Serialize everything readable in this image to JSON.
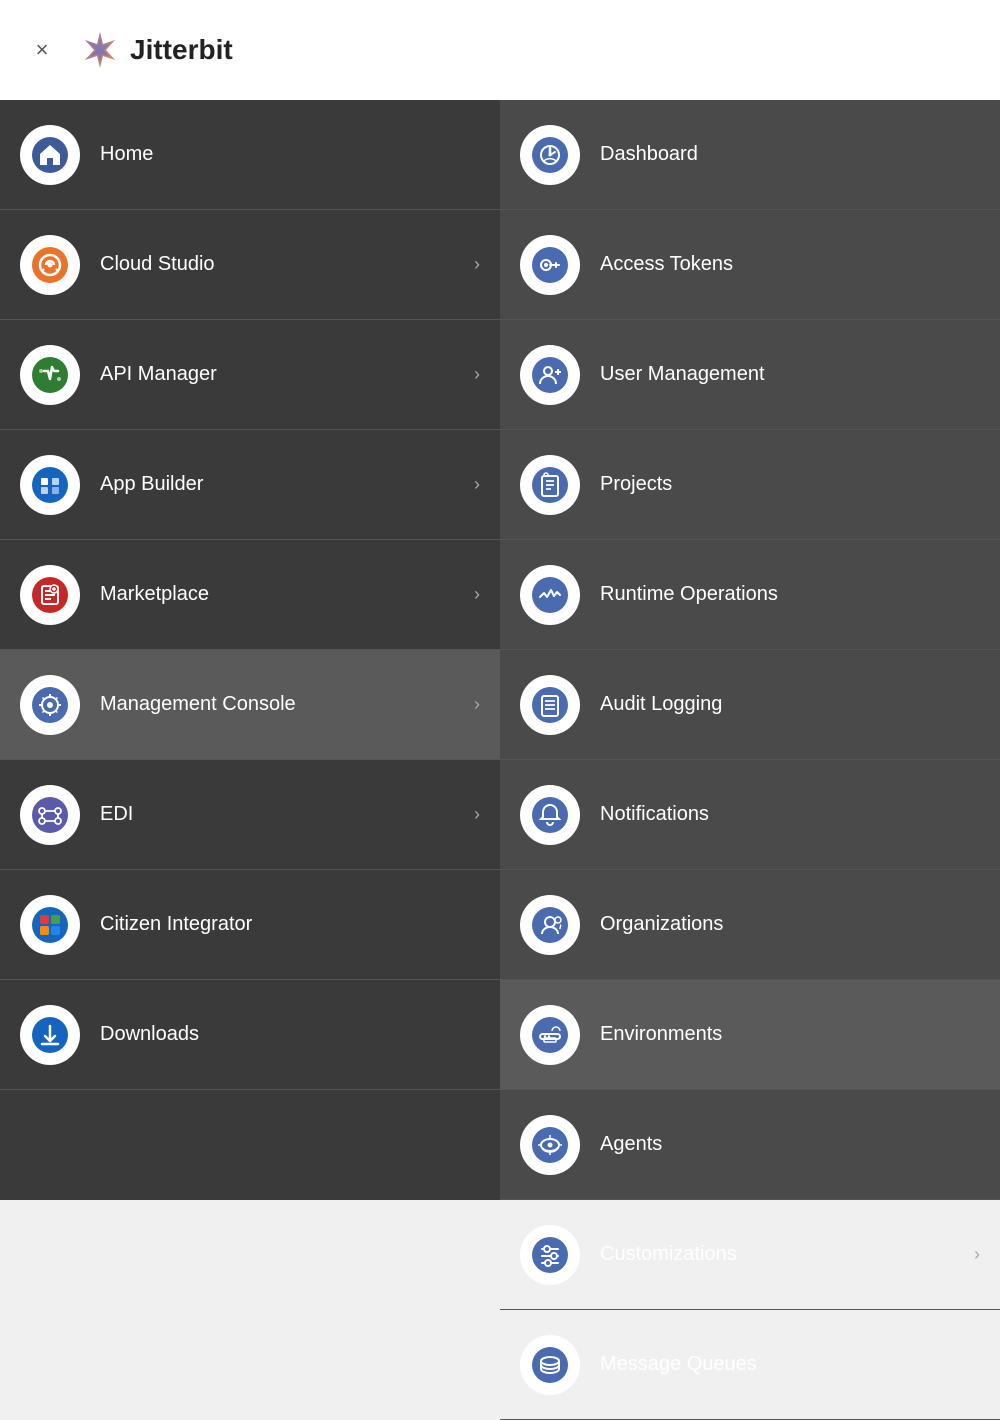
{
  "header": {
    "close_label": "×",
    "logo_text": "Jitterbit",
    "close_aria": "Close menu"
  },
  "left_nav": {
    "items": [
      {
        "id": "home",
        "label": "Home",
        "has_chevron": false,
        "icon": "home"
      },
      {
        "id": "cloud-studio",
        "label": "Cloud Studio",
        "has_chevron": true,
        "icon": "cloud-studio"
      },
      {
        "id": "api-manager",
        "label": "API Manager",
        "has_chevron": true,
        "icon": "api-manager"
      },
      {
        "id": "app-builder",
        "label": "App Builder",
        "has_chevron": true,
        "icon": "app-builder"
      },
      {
        "id": "marketplace",
        "label": "Marketplace",
        "has_chevron": true,
        "icon": "marketplace"
      },
      {
        "id": "management-console",
        "label": "Management Console",
        "has_chevron": true,
        "icon": "management-console",
        "active": true
      },
      {
        "id": "edi",
        "label": "EDI",
        "has_chevron": true,
        "icon": "edi"
      },
      {
        "id": "citizen-integrator",
        "label": "Citizen Integrator",
        "has_chevron": false,
        "icon": "citizen-integrator"
      },
      {
        "id": "downloads",
        "label": "Downloads",
        "has_chevron": false,
        "icon": "downloads"
      }
    ]
  },
  "right_nav": {
    "items": [
      {
        "id": "dashboard",
        "label": "Dashboard",
        "has_chevron": false,
        "icon": "dashboard"
      },
      {
        "id": "access-tokens",
        "label": "Access Tokens",
        "has_chevron": false,
        "icon": "access-tokens"
      },
      {
        "id": "user-management",
        "label": "User Management",
        "has_chevron": false,
        "icon": "user-management"
      },
      {
        "id": "projects",
        "label": "Projects",
        "has_chevron": false,
        "icon": "projects"
      },
      {
        "id": "runtime-operations",
        "label": "Runtime Operations",
        "has_chevron": false,
        "icon": "runtime-operations"
      },
      {
        "id": "audit-logging",
        "label": "Audit Logging",
        "has_chevron": false,
        "icon": "audit-logging"
      },
      {
        "id": "notifications",
        "label": "Notifications",
        "has_chevron": false,
        "icon": "notifications"
      },
      {
        "id": "organizations",
        "label": "Organizations",
        "has_chevron": false,
        "icon": "organizations"
      },
      {
        "id": "environments",
        "label": "Environments",
        "has_chevron": false,
        "icon": "environments",
        "active": true
      },
      {
        "id": "agents",
        "label": "Agents",
        "has_chevron": false,
        "icon": "agents"
      },
      {
        "id": "customizations",
        "label": "Customizations",
        "has_chevron": true,
        "icon": "customizations"
      },
      {
        "id": "message-queues",
        "label": "Message Queues",
        "has_chevron": false,
        "icon": "message-queues"
      }
    ]
  }
}
